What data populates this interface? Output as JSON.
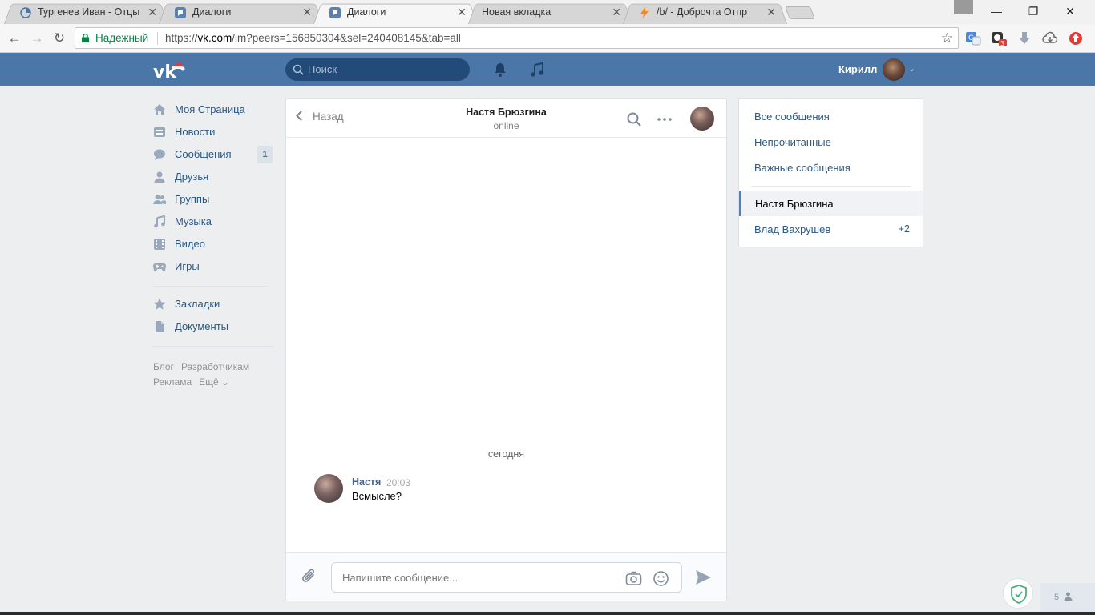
{
  "browser": {
    "tabs": [
      {
        "title": "Тургенев Иван - Отцы и",
        "favicon": "pie-icon",
        "active": false
      },
      {
        "title": "Диалоги",
        "favicon": "vk-chat-icon",
        "active": false
      },
      {
        "title": "Диалоги",
        "favicon": "vk-chat-icon",
        "active": true
      },
      {
        "title": "Новая вкладка",
        "favicon": "",
        "active": false
      },
      {
        "title": "/b/ - Доброчта Отпр",
        "favicon": "lightning-icon",
        "active": false
      }
    ],
    "secure_label": "Надежный",
    "url_prefix": "https://",
    "url_host": "vk.com",
    "url_path": "/im?peers=156850304&sel=240408145&tab=all",
    "extension_badge": "3"
  },
  "header": {
    "search_placeholder": "Поиск",
    "user_name": "Кирилл"
  },
  "left_menu": {
    "items": [
      {
        "label": "Моя Страница",
        "icon": "home-icon"
      },
      {
        "label": "Новости",
        "icon": "news-icon"
      },
      {
        "label": "Сообщения",
        "icon": "messages-icon",
        "count": "1"
      },
      {
        "label": "Друзья",
        "icon": "friends-icon"
      },
      {
        "label": "Группы",
        "icon": "groups-icon"
      },
      {
        "label": "Музыка",
        "icon": "music-icon"
      },
      {
        "label": "Видео",
        "icon": "video-icon"
      },
      {
        "label": "Игры",
        "icon": "games-icon"
      }
    ],
    "secondary": [
      {
        "label": "Закладки",
        "icon": "star-icon"
      },
      {
        "label": "Документы",
        "icon": "document-icon"
      }
    ],
    "footer": [
      "Блог",
      "Разработчикам",
      "Реклама",
      "Ещё ⌄"
    ]
  },
  "chat": {
    "back_label": "Назад",
    "peer_name": "Настя Брюзгина",
    "peer_status": "online",
    "day_separator": "сегодня",
    "messages": [
      {
        "author": "Настя",
        "time": "20:03",
        "text": "Всмысле?"
      }
    ],
    "input_placeholder": "Напишите сообщение..."
  },
  "folders": {
    "items": [
      "Все сообщения",
      "Непрочитанные",
      "Важные сообщения"
    ],
    "dialogs": [
      {
        "name": "Настя Брюзгина",
        "selected": true,
        "count": ""
      },
      {
        "name": "Влад Вахрушев",
        "selected": false,
        "count": "+2"
      }
    ]
  },
  "widgets": {
    "online_count": "5"
  },
  "colors": {
    "vk_blue": "#4a76a8",
    "link": "#2a5885",
    "page_bg": "#edeef0"
  }
}
